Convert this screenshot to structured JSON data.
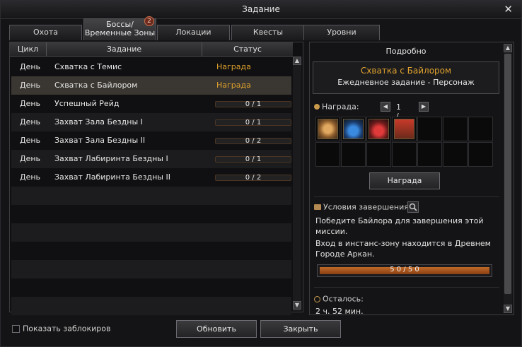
{
  "window": {
    "title": "Задание"
  },
  "icons": {
    "close": "close-icon",
    "reward": "coin-icon",
    "conditions": "scroll-icon",
    "search": "magnifier-icon",
    "remaining": "clock-icon"
  },
  "tabs": [
    {
      "label": "Охота"
    },
    {
      "label": "Боссы/ Временные Зоны",
      "badge": "2",
      "active": true
    },
    {
      "label": "Локации"
    },
    {
      "label": "Квесты"
    },
    {
      "label": "Уровни"
    }
  ],
  "list": {
    "headers": {
      "cycle": "Цикл",
      "task": "Задание",
      "status": "Статус"
    },
    "rows": [
      {
        "cycle": "День",
        "name": "Схватка с Темис",
        "status": "Награда доступна",
        "progress": null
      },
      {
        "cycle": "День",
        "name": "Схватка с Байлором",
        "status": "Награда доступна",
        "progress": null,
        "selected": true
      },
      {
        "cycle": "День",
        "name": "Успешный Рейд",
        "status": "0 / 1",
        "progress": 0
      },
      {
        "cycle": "День",
        "name": "Захват Зала Бездны I",
        "status": "0 / 1",
        "progress": 0
      },
      {
        "cycle": "День",
        "name": "Захват Зала Бездны II",
        "status": "0 / 2",
        "progress": 0
      },
      {
        "cycle": "День",
        "name": "Захват Лабиринта Бездны I",
        "status": "0 / 1",
        "progress": 0
      },
      {
        "cycle": "День",
        "name": "Захват Лабиринта Бездны II",
        "status": "0 / 2",
        "progress": 0
      }
    ],
    "empty_rows": 7
  },
  "detail": {
    "title": "Подробно",
    "quest_name": "Схватка с Байлором",
    "quest_type": "Ежедневное задание  -  Персонаж",
    "reward_label": "Награда:",
    "reward_page": "1 / 1",
    "reward_items": [
      "gold-coin",
      "blue-potion",
      "red-potion",
      "treasure-chest"
    ],
    "reward_button": "Награда",
    "conditions_label": "Условия завершения:",
    "condition_text_1": "Победите Байлора для завершения этой миссии.",
    "condition_text_2": "Вход в инстанс-зону находится в Древнем Городе Аркан.",
    "progress_text": "5 0 / 5 0",
    "progress_value": 1.0,
    "remaining_label": "Осталось:",
    "remaining_time": "2 ч. 52 мин."
  },
  "footer": {
    "show_locked_label": "Показать заблокиров",
    "show_locked_checked": false,
    "refresh_button": "Обновить",
    "close_button": "Закрыть"
  },
  "colors": {
    "accent": "#e0a22d",
    "progress_fill": "#b45f22"
  }
}
